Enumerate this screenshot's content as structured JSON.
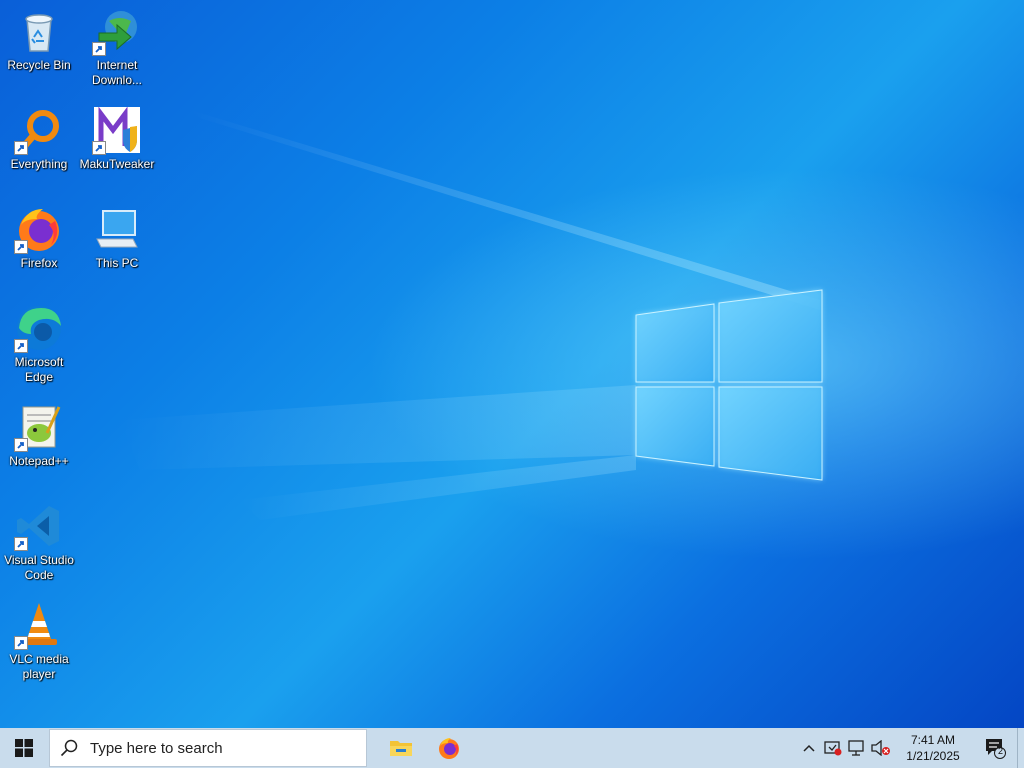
{
  "desktop": {
    "icons": [
      {
        "label": "Recycle Bin",
        "icon": "recycle-bin-icon"
      },
      {
        "label": "Internet\nDownlo...",
        "icon": "internet-download-manager-icon"
      },
      {
        "label": "Everything",
        "icon": "everything-search-icon"
      },
      {
        "label": "MakuTweaker",
        "icon": "makutweaker-icon"
      },
      {
        "label": "Firefox",
        "icon": "firefox-icon"
      },
      {
        "label": "This PC",
        "icon": "this-pc-icon"
      },
      {
        "label": "Microsoft\nEdge",
        "icon": "edge-icon"
      },
      {
        "label": "Notepad++",
        "icon": "notepad-plus-plus-icon"
      },
      {
        "label": "Visual Studio\nCode",
        "icon": "vscode-icon"
      },
      {
        "label": "VLC media\nplayer",
        "icon": "vlc-icon"
      }
    ]
  },
  "taskbar": {
    "start": "windows-start-icon",
    "search_placeholder": "Type here to search",
    "pinned": [
      {
        "name": "file-explorer",
        "icon": "file-explorer-icon"
      },
      {
        "name": "firefox",
        "icon": "firefox-icon"
      }
    ],
    "tray": {
      "time": "7:41 AM",
      "date": "1/21/2025",
      "notification_count": "2"
    }
  },
  "colors": {
    "wallpaper": "#0b76e2",
    "taskbar": "#c9dcec",
    "logo_glow": "#7fdcff"
  }
}
